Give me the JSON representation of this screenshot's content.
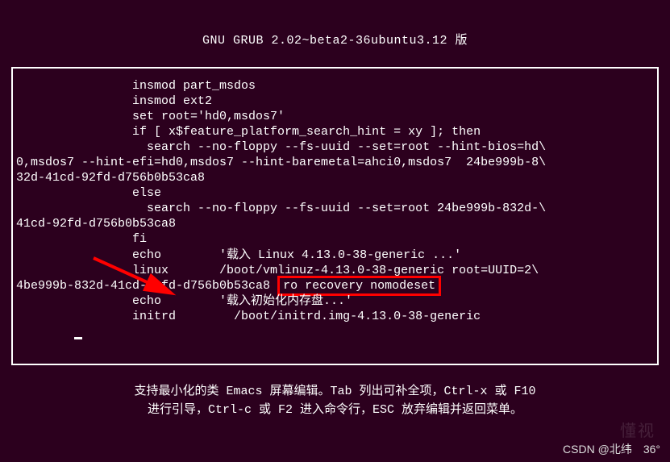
{
  "header": {
    "title": "GNU GRUB  2.02~beta2-36ubuntu3.12 版"
  },
  "grub": {
    "lines": [
      "                insmod part_msdos",
      "                insmod ext2",
      "                set root='hd0,msdos7'",
      "                if [ x$feature_platform_search_hint = xy ]; then",
      "                  search --no-floppy --fs-uuid --set=root --hint-bios=hd\\",
      "0,msdos7 --hint-efi=hd0,msdos7 --hint-baremetal=ahci0,msdos7  24be999b-8\\",
      "32d-41cd-92fd-d756b0b53ca8",
      "                else",
      "                  search --no-floppy --fs-uuid --set=root 24be999b-832d-\\",
      "41cd-92fd-d756b0b53ca8",
      "                fi",
      "                echo        '载入 Linux 4.13.0-38-generic ...'",
      "                linux       /boot/vmlinuz-4.13.0-38-generic root=UUID=2\\",
      "4be999b-832d-41cd-92fd-d756b0b53ca8 ",
      "                echo        '载入初始化内存盘...'",
      "                initrd        /boot/initrd.img-4.13.0-38-generic"
    ],
    "highlight": "ro recovery nomodeset"
  },
  "footer": {
    "line1": "支持最小化的类 Emacs 屏幕编辑。Tab 列出可补全项，Ctrl-x 或 F10",
    "line2": "进行引导，Ctrl-c 或 F2 进入命令行，ESC 放弃编辑并返回菜单。"
  },
  "watermark": {
    "author": "CSDN @北纬　36°",
    "logo": "懂视"
  }
}
